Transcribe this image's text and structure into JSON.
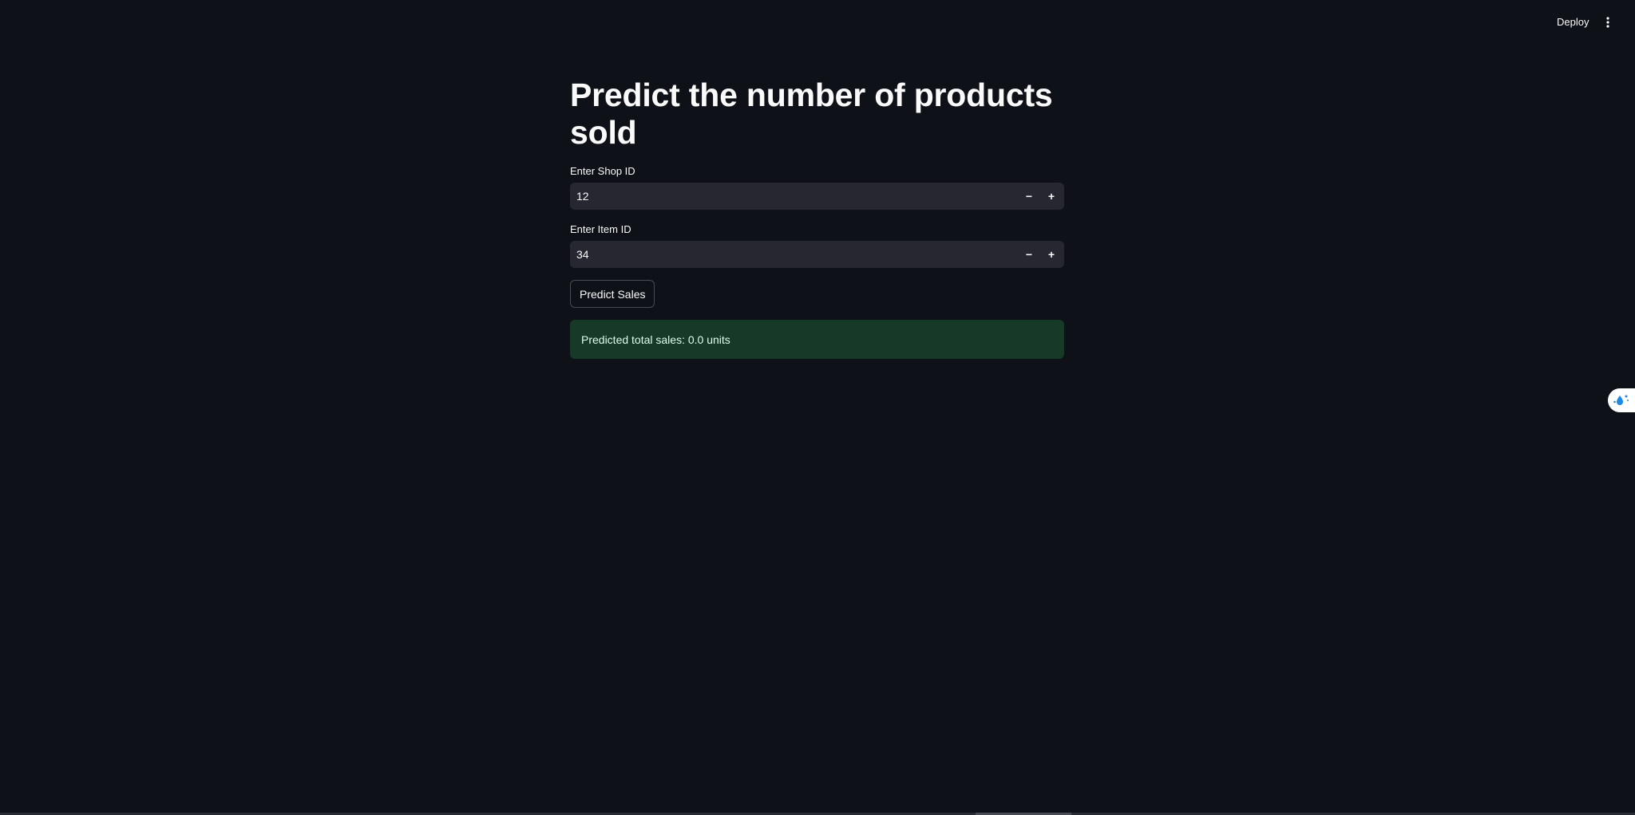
{
  "header": {
    "deploy_label": "Deploy",
    "menu_icon": "vertical-ellipsis-icon"
  },
  "main": {
    "title": "Predict the number of products sold",
    "shop_field": {
      "label": "Enter Shop ID",
      "value": "12"
    },
    "item_field": {
      "label": "Enter Item ID",
      "value": "34"
    },
    "stepper": {
      "minus": "−",
      "plus": "+"
    },
    "predict_button_label": "Predict Sales",
    "result_text": "Predicted total sales: 0.0 units"
  },
  "colors": {
    "background": "#0e1117",
    "input_background": "#262730",
    "success_background": "#173928",
    "text": "#fafafa"
  }
}
